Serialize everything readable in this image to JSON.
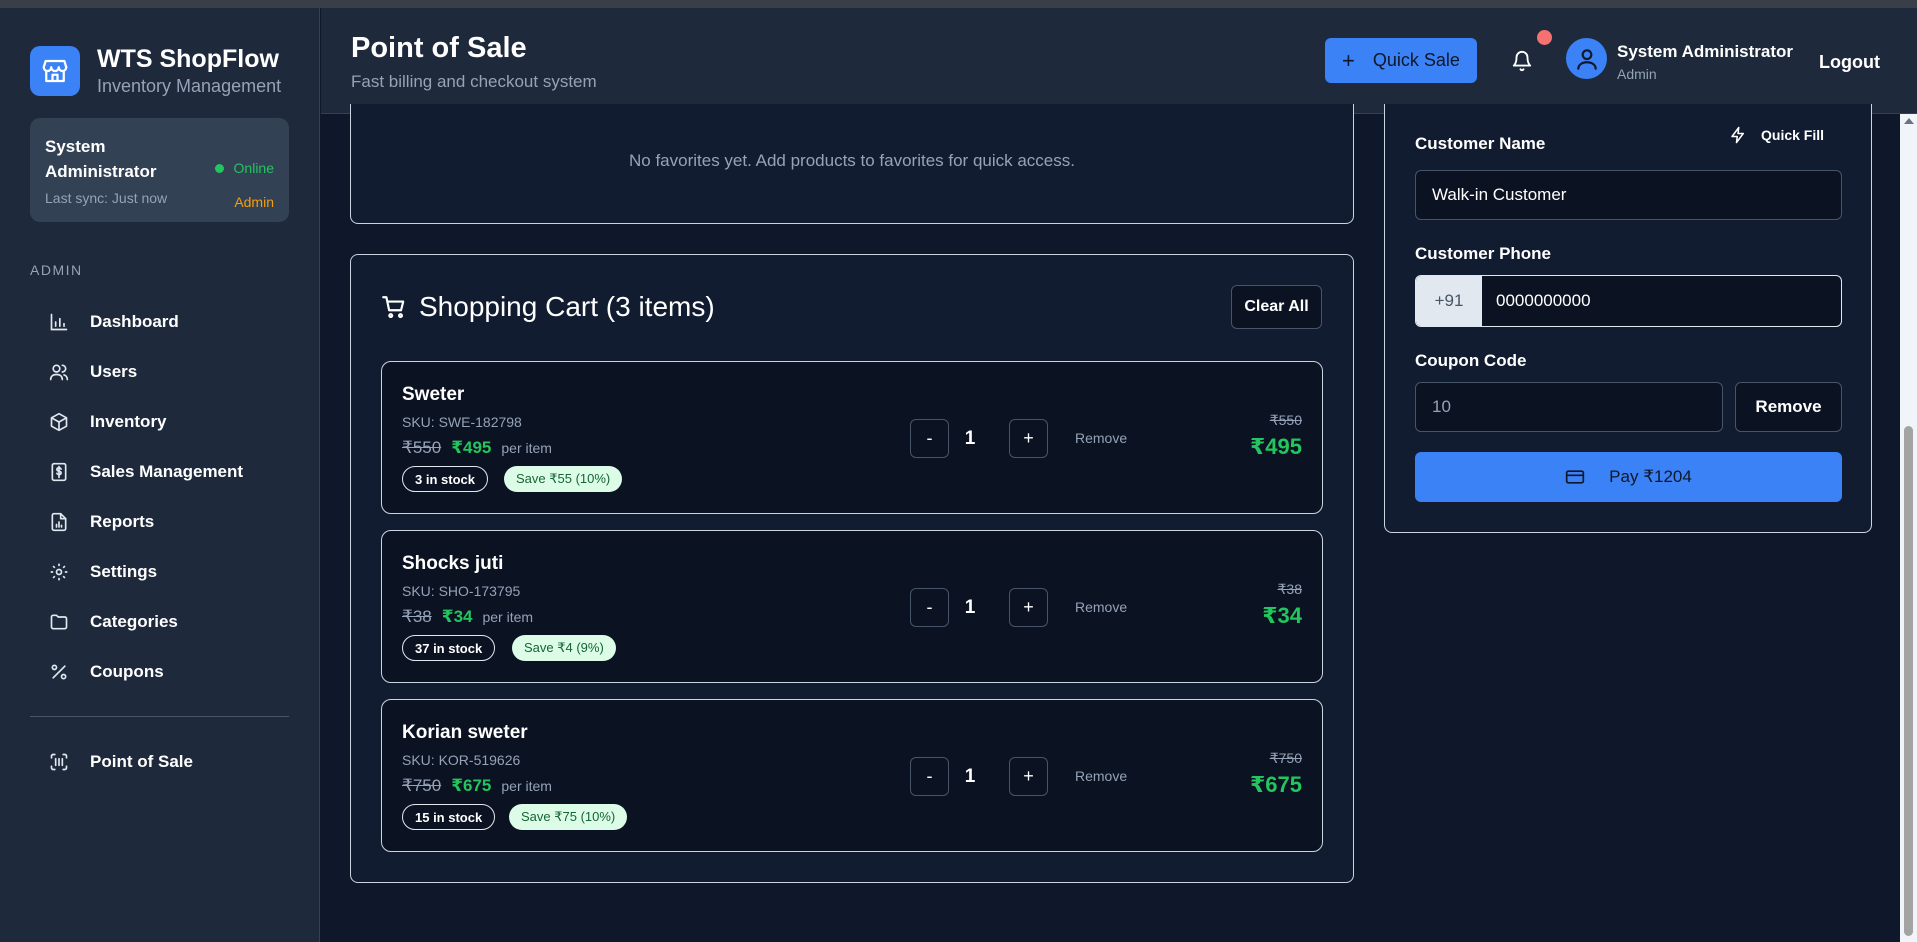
{
  "brand": {
    "title": "WTS ShopFlow",
    "subtitle": "Inventory Management"
  },
  "user_card": {
    "name": "System Administrator",
    "status": "Online",
    "last_sync": "Last sync: Just now",
    "role": "Admin"
  },
  "nav": {
    "section": "ADMIN",
    "items": [
      {
        "label": "Dashboard",
        "icon": "bar-chart-icon"
      },
      {
        "label": "Users",
        "icon": "users-icon"
      },
      {
        "label": "Inventory",
        "icon": "box-icon"
      },
      {
        "label": "Sales Management",
        "icon": "dollar-receipt-icon"
      },
      {
        "label": "Reports",
        "icon": "report-icon"
      },
      {
        "label": "Settings",
        "icon": "gear-icon"
      },
      {
        "label": "Categories",
        "icon": "folder-icon"
      },
      {
        "label": "Coupons",
        "icon": "percent-icon"
      }
    ],
    "pos": {
      "label": "Point of Sale",
      "icon": "barcode-scan-icon"
    }
  },
  "header": {
    "title": "Point of Sale",
    "subtitle": "Fast billing and checkout system",
    "quick_sale": "Quick Sale",
    "user_name": "System Administrator",
    "user_role": "Admin",
    "logout": "Logout"
  },
  "favorites": {
    "empty": "No favorites yet. Add products to favorites for quick access."
  },
  "cart": {
    "title": "Shopping Cart (3 items)",
    "clear_all": "Clear All",
    "remove_label": "Remove",
    "minus": "-",
    "plus": "+",
    "per_item": "per item",
    "items": [
      {
        "name": "Sweter",
        "sku": "SKU: SWE-182798",
        "orig": "₹550",
        "price": "₹495",
        "stock": "3 in stock",
        "save": "Save ₹55 (10%)",
        "qty": "1",
        "line_orig": "₹550",
        "line_total": "₹495"
      },
      {
        "name": "Shocks juti",
        "sku": "SKU: SHO-173795",
        "orig": "₹38",
        "price": "₹34",
        "stock": "37 in stock",
        "save": "Save ₹4 (9%)",
        "qty": "1",
        "line_orig": "₹38",
        "line_total": "₹34"
      },
      {
        "name": "Korian sweter",
        "sku": "SKU: KOR-519626",
        "orig": "₹750",
        "price": "₹675",
        "stock": "15 in stock",
        "save": "Save ₹75 (10%)",
        "qty": "1",
        "line_orig": "₹750",
        "line_total": "₹675"
      }
    ]
  },
  "checkout": {
    "customer_name_label": "Customer Name",
    "quick_fill": "Quick Fill",
    "customer_name_value": "Walk-in Customer",
    "customer_phone_label": "Customer Phone",
    "phone_prefix": "+91",
    "phone_value": "0000000000",
    "coupon_label": "Coupon Code",
    "coupon_value": "10",
    "coupon_remove": "Remove",
    "pay": "Pay ₹1204"
  },
  "colors": {
    "accent": "#3b82f6",
    "success": "#22c55e",
    "warning": "#f59e0b",
    "notification": "#f87171"
  }
}
